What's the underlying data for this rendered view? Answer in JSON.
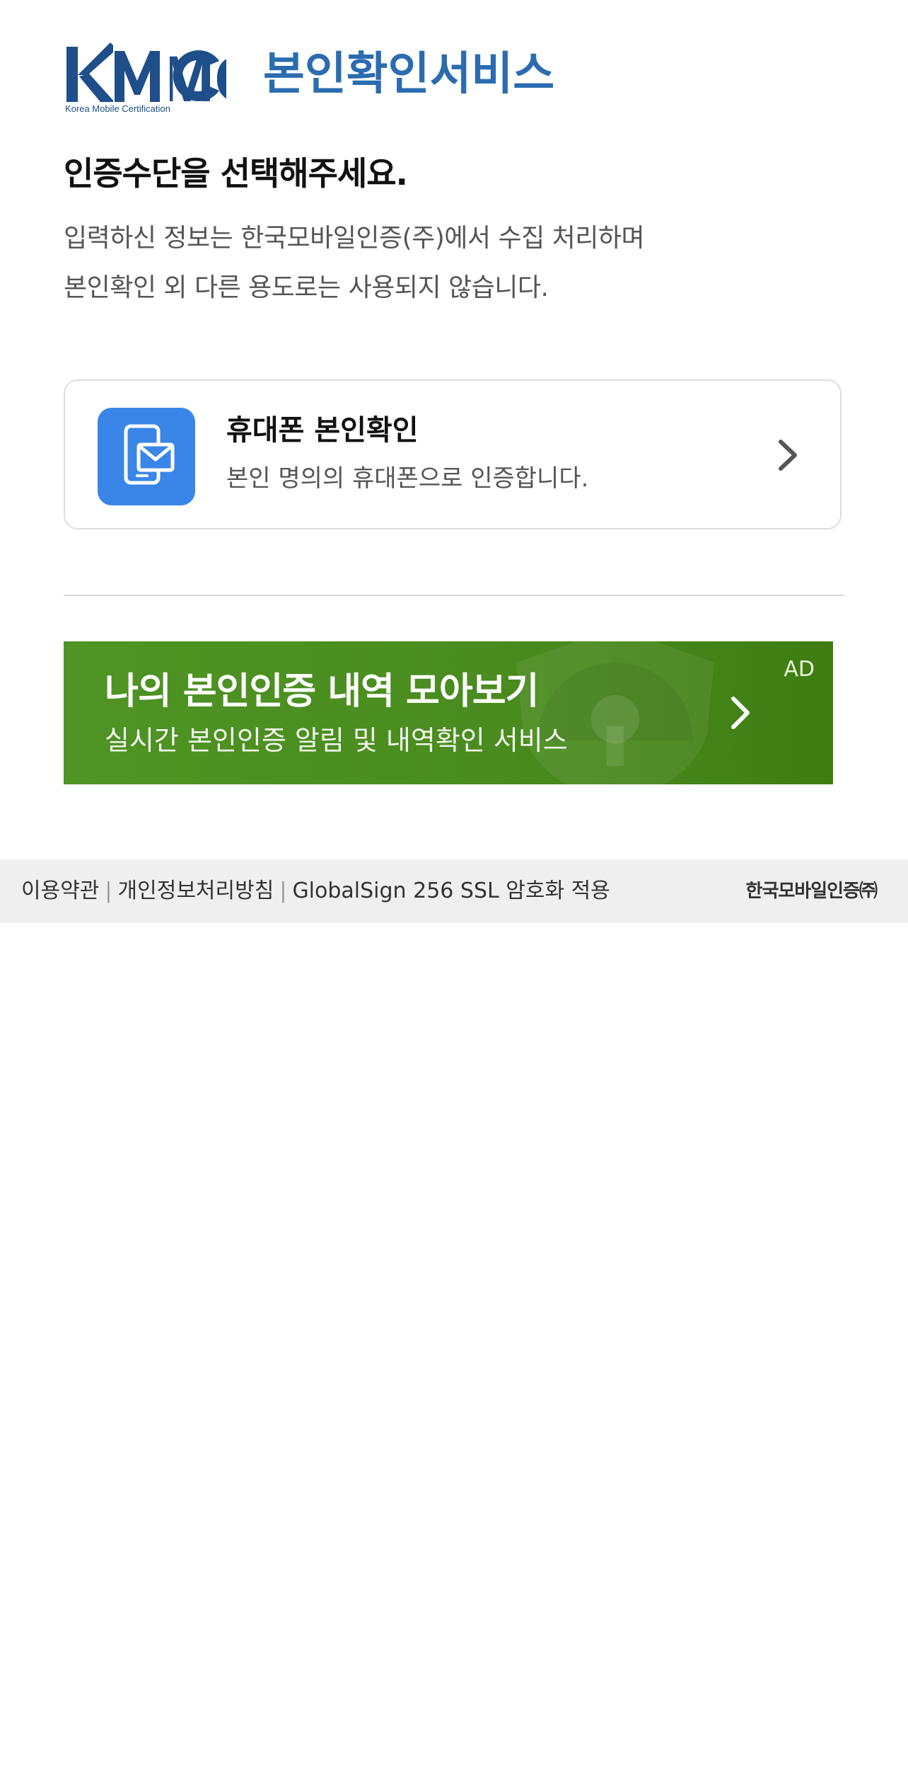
{
  "header": {
    "logo_text": "KMC",
    "logo_tagline": "Korea Mobile Certification",
    "service_title": "본인확인서비스",
    "brand_color": "#2b6cb0"
  },
  "intro": {
    "heading": "인증수단을 선택해주세요.",
    "description_line1": "입력하신 정보는 한국모바일인증(주)에서 수집 처리하며",
    "description_line2": "본인확인 외 다른 용도로는 사용되지 않습니다."
  },
  "methods": [
    {
      "title": "휴대폰 본인확인",
      "description": "본인 명의의 휴대폰으로 인증합니다.",
      "icon": "phone-message-icon",
      "icon_color": "#3a86e8"
    }
  ],
  "ad": {
    "title": "나의 본인인증 내역 모아보기",
    "subtitle": "실시간 본인인증 알림 및 내역확인 서비스",
    "label": "AD",
    "background_color": "#4a8c1f"
  },
  "footer": {
    "links": [
      "이용약관",
      "개인정보처리방침",
      "GlobalSign 256 SSL 암호화 적용"
    ],
    "separator": "|",
    "brand": "한국모바일인증㈜",
    "background_color": "#efefef"
  }
}
